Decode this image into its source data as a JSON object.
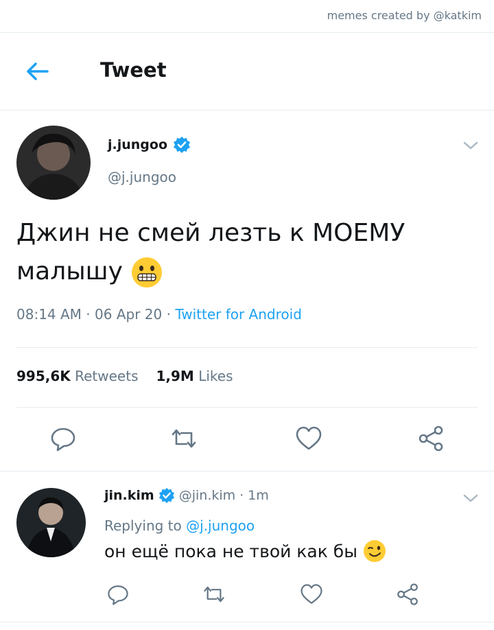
{
  "watermark": "memes created by @katkim",
  "header": {
    "title": "Tweet"
  },
  "tweet": {
    "display_name": "j.jungoo",
    "handle": "@j.jungoo",
    "text_line1": "Джин не смей лезть к МОЕМУ",
    "text_line2": "малышу",
    "time": "08:14 AM",
    "date": "06 Apr 20",
    "source": "Twitter for Android",
    "retweets_count": "995,6K",
    "retweets_label": "Retweets",
    "likes_count": "1,9M",
    "likes_label": "Likes"
  },
  "reply": {
    "display_name": "jin.kim",
    "handle": "@jin.kim",
    "time_ago": "1m",
    "replying_prefix": "Replying to",
    "replying_to": "@j.jungoo",
    "text": "он ещё пока не твой как бы"
  },
  "icons": {
    "back": "arrow-left-icon",
    "verified": "verified-badge-icon",
    "chevron": "chevron-down-icon",
    "reply": "reply-icon",
    "retweet": "retweet-icon",
    "like": "heart-icon",
    "share": "share-icon"
  },
  "colors": {
    "accent": "#1da1f2",
    "muted": "#657786",
    "text": "#14171a",
    "divider": "#e6ecf0"
  }
}
